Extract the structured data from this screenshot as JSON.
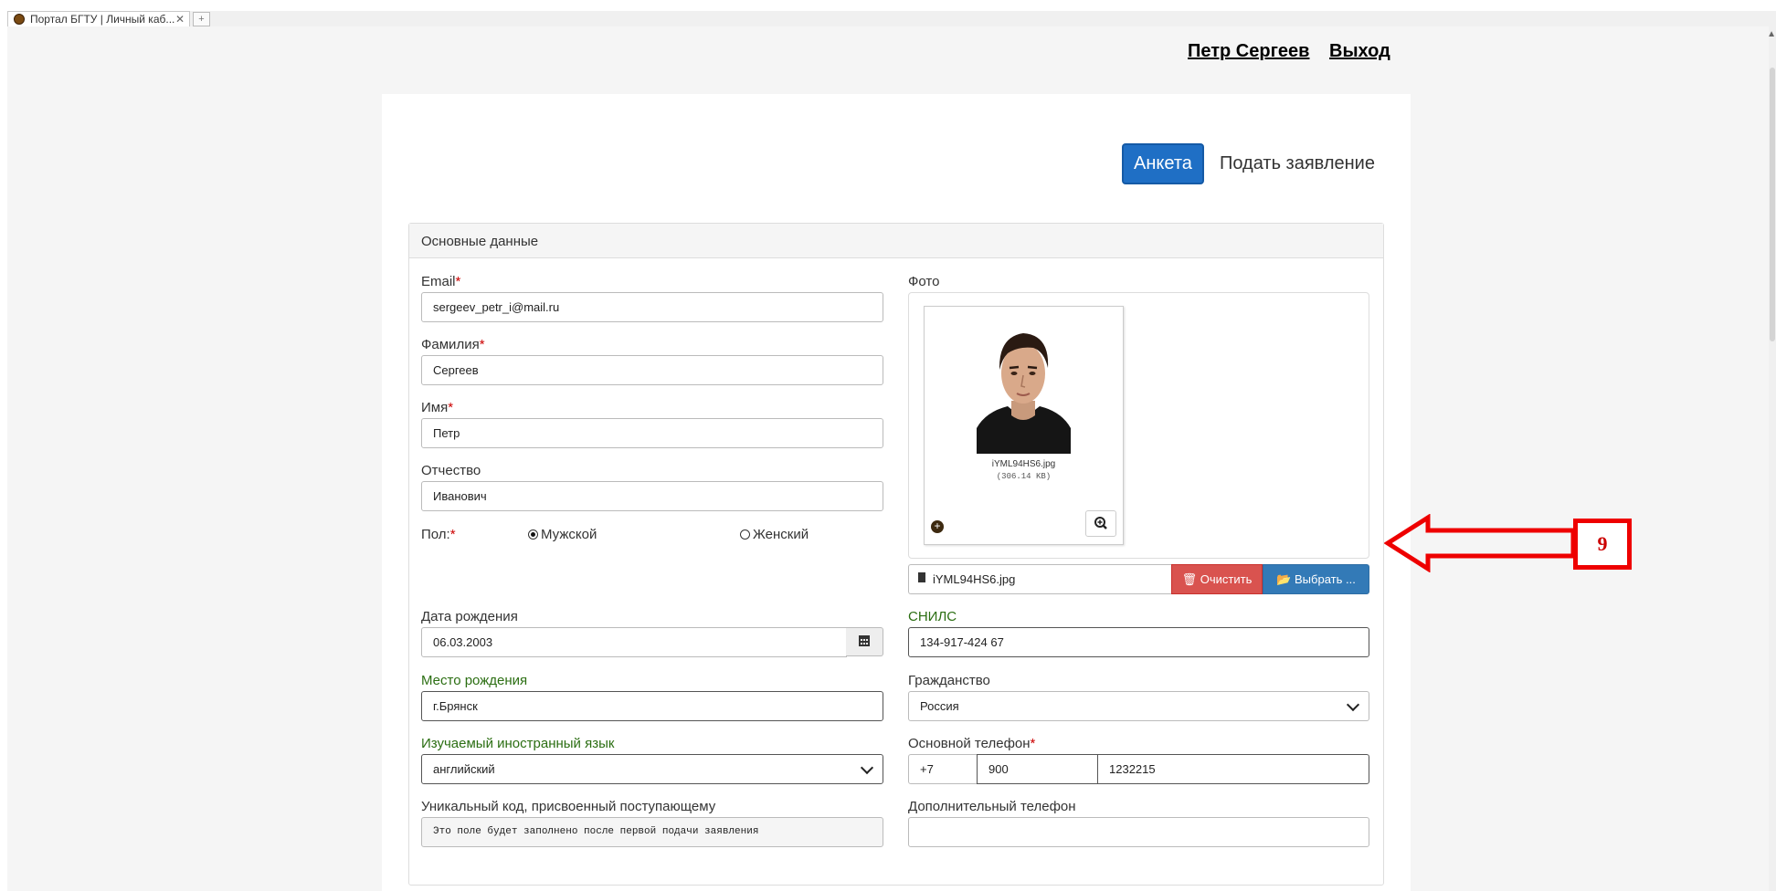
{
  "browser": {
    "tab_title": "Портал БГТУ | Личный каб...",
    "tab_close": "✕"
  },
  "header": {
    "user_name": "Петр Сергеев",
    "logout": "Выход"
  },
  "tabs": {
    "anketa": "Анкета",
    "apply": "Подать заявление"
  },
  "panel": {
    "title": "Основные данные"
  },
  "form": {
    "email": {
      "label": "Email",
      "required": "*",
      "value": "sergeev_petr_i@mail.ru"
    },
    "surname": {
      "label": "Фамилия",
      "required": "*",
      "value": "Сергеев"
    },
    "name": {
      "label": "Имя",
      "required": "*",
      "value": "Петр"
    },
    "patronymic": {
      "label": "Отчество",
      "value": "Иванович"
    },
    "gender": {
      "label": "Пол:",
      "required": "*",
      "male": "Мужской",
      "female": "Женский",
      "selected": "male"
    },
    "photo": {
      "label": "Фото",
      "file_name": "iYML94HS6.jpg",
      "file_size": "(306.14 KB)",
      "field_value": "iYML94HS6.jpg",
      "clear_label": "Очистить",
      "choose_label": "Выбрать ..."
    },
    "birth_date": {
      "label": "Дата рождения",
      "value": "06.03.2003"
    },
    "snils": {
      "label": "СНИЛС",
      "value": "134-917-424 67"
    },
    "birth_place": {
      "label": "Место рождения",
      "value": "г.Брянск"
    },
    "citizenship": {
      "label": "Гражданство",
      "value": "Россия"
    },
    "language": {
      "label": "Изучаемый иностранный язык",
      "value": "английский"
    },
    "phone": {
      "label": "Основной телефон",
      "required": "*",
      "code": "+7",
      "operator": "900",
      "number": "1232215"
    },
    "unique_code": {
      "label": "Уникальный код, присвоенный поступающему",
      "value": "Это поле будет заполнено после первой подачи заявления"
    },
    "extra_phone": {
      "label": "Дополнительный телефон",
      "value": ""
    }
  },
  "annotation": {
    "callout_number": "9",
    "color": "#e00000"
  },
  "colors": {
    "primary": "#1f6fc5",
    "danger": "#d9534f",
    "label_green": "#2b6e12"
  }
}
